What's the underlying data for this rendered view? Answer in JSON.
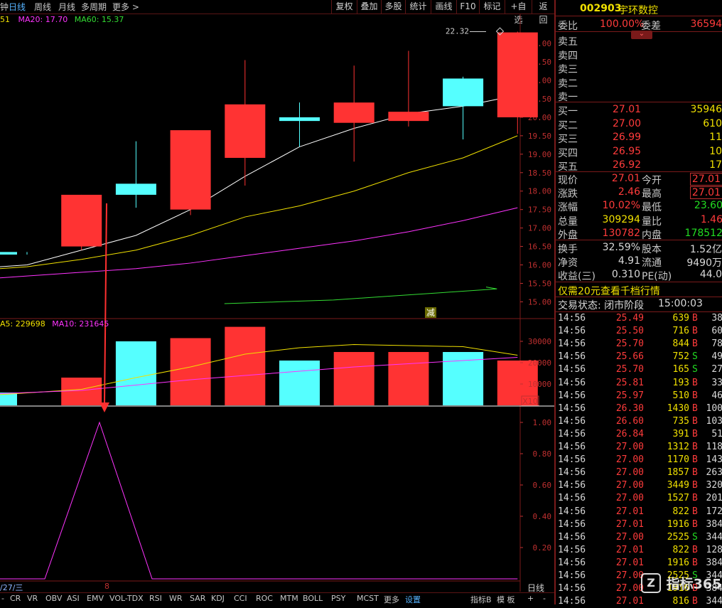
{
  "toolbar": {
    "tabs": [
      "钟",
      "日线",
      "周线",
      "月线",
      "多周期",
      "更多 >"
    ],
    "active_tab": "日线",
    "buttons": [
      "复权",
      "叠加",
      "多股",
      "统计",
      "画线",
      "F10",
      "标记",
      "+自选",
      "返回"
    ]
  },
  "ma_legend": {
    "ma10": "51",
    "ma20": "MA20: 17.70",
    "ma60": "MA60: 15.37"
  },
  "vol_legend": {
    "ma5": "A5: 229698",
    "ma10": "MA10: 231645"
  },
  "price_axis": [
    "22.00",
    "21.50",
    "21.00",
    "20.50",
    "20.00",
    "19.50",
    "19.00",
    "18.50",
    "18.00",
    "17.50",
    "17.00",
    "16.50",
    "16.00",
    "15.50",
    "15.00"
  ],
  "vol_axis": [
    "30000",
    "20000",
    "10000"
  ],
  "vol_unit": "X10",
  "ind_axis": [
    "1.00",
    "0.80",
    "0.60",
    "0.40",
    "0.20"
  ],
  "max_label": "22.32",
  "event_label": "减",
  "date_labels": {
    "left": "/27/三",
    "marker": "8"
  },
  "bottom_tabs": [
    "CR",
    "VR",
    "OBV",
    "ASI",
    "EMV",
    "VOL-TDX",
    "RSI",
    "WR",
    "SAR",
    "KDJ",
    "CCI",
    "ROC",
    "MTM",
    "BOLL",
    "PSY",
    "MCST",
    "更多",
    "设置"
  ],
  "bottom_right": {
    "indicator": "指标B",
    "template": "模 板",
    "plus": "+",
    "minus": "-"
  },
  "day_label": "日线",
  "colors": {
    "up": "#ff3333",
    "down": "#55ffff",
    "ma5": "#ffffff",
    "ma10": "#f0e000",
    "ma20": "#ff33ff",
    "ma60": "#33dd33",
    "frame": "#7a1a1a"
  },
  "chart_data": {
    "type": "candlestick",
    "y_range": [
      14.7,
      22.6
    ],
    "candles": [
      {
        "open": 16.35,
        "close": 16.28,
        "high": 16.35,
        "low": 16.28,
        "dir": "down"
      },
      {
        "open": 16.5,
        "close": 17.9,
        "high": 17.9,
        "low": 16.4,
        "dir": "up"
      },
      {
        "open": 18.2,
        "close": 17.9,
        "high": 19.35,
        "low": 17.55,
        "dir": "down"
      },
      {
        "open": 17.5,
        "close": 19.65,
        "high": 19.65,
        "low": 17.35,
        "dir": "up"
      },
      {
        "open": 18.9,
        "close": 20.35,
        "high": 21.55,
        "low": 18.15,
        "dir": "up"
      },
      {
        "open": 20.0,
        "close": 19.9,
        "high": 20.4,
        "low": 19.2,
        "dir": "down"
      },
      {
        "open": 19.85,
        "close": 20.4,
        "high": 21.4,
        "low": 18.8,
        "dir": "up"
      },
      {
        "open": 19.9,
        "close": 20.15,
        "high": 21.8,
        "low": 19.75,
        "dir": "up"
      },
      {
        "open": 21.05,
        "close": 20.3,
        "high": 21.1,
        "low": 19.4,
        "dir": "down"
      },
      {
        "open": 20.0,
        "close": 22.3,
        "high": 22.32,
        "low": 19.55,
        "dir": "up"
      }
    ],
    "ma5": [
      16.0,
      16.4,
      16.8,
      17.5,
      18.4,
      19.2,
      19.7,
      20.1,
      20.3,
      20.6
    ],
    "ma10": [
      15.95,
      16.15,
      16.4,
      16.8,
      17.3,
      17.6,
      18.0,
      18.5,
      18.9,
      19.5
    ],
    "ma20": [
      15.7,
      15.8,
      15.9,
      16.05,
      16.25,
      16.45,
      16.65,
      16.9,
      17.2,
      17.55
    ],
    "ma60": [
      null,
      null,
      null,
      null,
      14.95,
      15.0,
      15.05,
      15.15,
      15.25,
      15.35
    ],
    "volume": {
      "y_range": [
        0,
        38000
      ],
      "bars": [
        {
          "value": 6000,
          "dir": "down"
        },
        {
          "value": 13000,
          "dir": "up"
        },
        {
          "value": 30000,
          "dir": "down"
        },
        {
          "value": 31500,
          "dir": "up"
        },
        {
          "value": 36800,
          "dir": "up"
        },
        {
          "value": 21000,
          "dir": "down"
        },
        {
          "value": 25000,
          "dir": "up"
        },
        {
          "value": 25000,
          "dir": "up"
        },
        {
          "value": 25000,
          "dir": "down"
        },
        {
          "value": 21000,
          "dir": "up"
        }
      ],
      "ma5": [
        null,
        7500,
        13000,
        18000,
        24000,
        27000,
        28500,
        28000,
        27500,
        23500
      ],
      "ma10": [
        null,
        7000,
        9500,
        12000,
        14000,
        16000,
        18000,
        19500,
        21000,
        22500
      ]
    },
    "indicator": {
      "y_range": [
        0,
        1.1
      ],
      "values": [
        0,
        0,
        1.0,
        0,
        0,
        0,
        0,
        0,
        0,
        0
      ]
    }
  },
  "quote": {
    "code": "002903",
    "name": "宇环数控",
    "weibi_label": "委比",
    "weibi": "100.00%",
    "weicha_label": "委差",
    "weicha": "36594",
    "sell": [
      {
        "label": "卖五"
      },
      {
        "label": "卖四"
      },
      {
        "label": "卖三"
      },
      {
        "label": "卖二"
      },
      {
        "label": "卖一"
      }
    ],
    "buy": [
      {
        "label": "买一",
        "price": "27.01",
        "vol": "35946"
      },
      {
        "label": "买二",
        "price": "27.00",
        "vol": "610"
      },
      {
        "label": "买三",
        "price": "26.99",
        "vol": "11"
      },
      {
        "label": "买四",
        "price": "26.95",
        "vol": "10"
      },
      {
        "label": "买五",
        "price": "26.92",
        "vol": "17"
      }
    ],
    "stats": [
      {
        "l1": "现价",
        "v1": "27.01",
        "c1": "red",
        "l2": "今开",
        "v2": "27.01",
        "c2": "red",
        "b2": true
      },
      {
        "l1": "涨跌",
        "v1": "2.46",
        "c1": "red",
        "l2": "最高",
        "v2": "27.01",
        "c2": "red",
        "b2": true
      },
      {
        "l1": "涨幅",
        "v1": "10.02%",
        "c1": "red",
        "l2": "最低",
        "v2": "23.60",
        "c2": "grn",
        "b2": false
      },
      {
        "l1": "总量",
        "v1": "309294",
        "c1": "yel",
        "l2": "量比",
        "v2": "1.46",
        "c2": "red",
        "b2": false
      },
      {
        "l1": "外盘",
        "v1": "130782",
        "c1": "red",
        "l2": "内盘",
        "v2": "178512",
        "c2": "grn",
        "b2": false
      }
    ],
    "stats2": [
      {
        "l1": "换手",
        "v1": "32.59%",
        "l2": "股本",
        "v2": "1.52亿"
      },
      {
        "l1": "净资",
        "v1": "4.91",
        "l2": "流通",
        "v2": "9490万"
      },
      {
        "l1": "收益(三)",
        "v1": "0.310",
        "l2": "PE(动)",
        "v2": "44.0"
      }
    ],
    "promo": "仅需20元查看千档行情",
    "status_label": "交易状态: 闭市阶段",
    "status_time": "15:00:03"
  },
  "ticks": [
    {
      "t": "14:56",
      "p": "25.49",
      "v": "639",
      "bs": "B",
      "n": "38"
    },
    {
      "t": "14:56",
      "p": "25.50",
      "v": "716",
      "bs": "B",
      "n": "60"
    },
    {
      "t": "14:56",
      "p": "25.70",
      "v": "844",
      "bs": "B",
      "n": "78"
    },
    {
      "t": "14:56",
      "p": "25.66",
      "v": "752",
      "bs": "S",
      "n": "49"
    },
    {
      "t": "14:56",
      "p": "25.70",
      "v": "165",
      "bs": "S",
      "n": "27"
    },
    {
      "t": "14:56",
      "p": "25.81",
      "v": "193",
      "bs": "B",
      "n": "33"
    },
    {
      "t": "14:56",
      "p": "25.97",
      "v": "510",
      "bs": "B",
      "n": "46"
    },
    {
      "t": "14:56",
      "p": "26.30",
      "v": "1430",
      "bs": "B",
      "n": "100"
    },
    {
      "t": "14:56",
      "p": "26.60",
      "v": "735",
      "bs": "B",
      "n": "103"
    },
    {
      "t": "14:56",
      "p": "26.84",
      "v": "391",
      "bs": "B",
      "n": "51"
    },
    {
      "t": "14:56",
      "p": "27.00",
      "v": "1312",
      "bs": "B",
      "n": "118"
    },
    {
      "t": "14:56",
      "p": "27.00",
      "v": "1170",
      "bs": "B",
      "n": "143"
    },
    {
      "t": "14:56",
      "p": "27.00",
      "v": "1857",
      "bs": "B",
      "n": "263"
    },
    {
      "t": "14:56",
      "p": "27.00",
      "v": "3449",
      "bs": "B",
      "n": "320"
    },
    {
      "t": "14:56",
      "p": "27.00",
      "v": "1527",
      "bs": "B",
      "n": "201"
    },
    {
      "t": "14:56",
      "p": "27.01",
      "v": "822",
      "bs": "B",
      "n": "172"
    },
    {
      "t": "14:56",
      "p": "27.01",
      "v": "1916",
      "bs": "B",
      "n": "384"
    },
    {
      "t": "14:56",
      "p": "27.00",
      "v": "2525",
      "bs": "S",
      "n": "344"
    },
    {
      "t": "14:56",
      "p": "27.01",
      "v": "822",
      "bs": "B",
      "n": "128"
    },
    {
      "t": "14:56",
      "p": "27.01",
      "v": "1916",
      "bs": "B",
      "n": "384"
    },
    {
      "t": "14:56",
      "p": "27.00",
      "v": "2525",
      "bs": "S",
      "n": "344"
    },
    {
      "t": "14:56",
      "p": "27.00",
      "v": "1916",
      "bs": "B",
      "n": "384"
    },
    {
      "t": "14:56",
      "p": "27.01",
      "v": "816",
      "bs": "B",
      "n": "344"
    }
  ],
  "watermark": "指标365"
}
